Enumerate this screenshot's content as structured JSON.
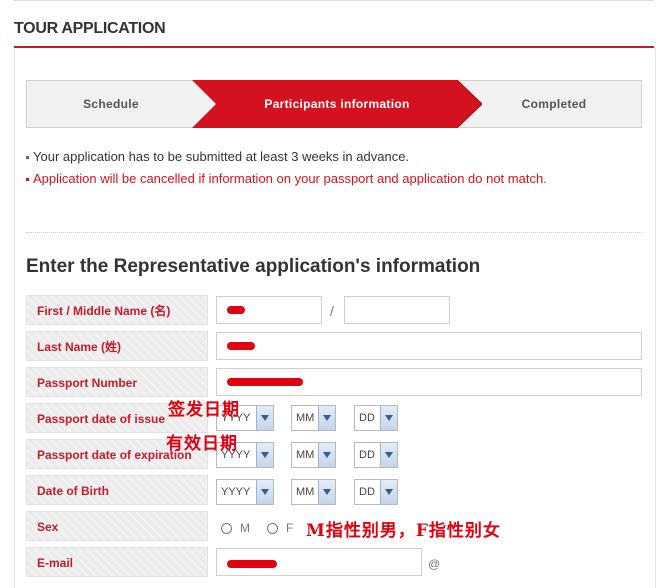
{
  "header": {
    "title": "TOUR APPLICATION"
  },
  "steps": [
    {
      "label": "Schedule",
      "active": false
    },
    {
      "label": "Participants information",
      "active": true
    },
    {
      "label": "Completed",
      "active": false
    }
  ],
  "notices": [
    "Your application has to be submitted at least 3 weeks in advance.",
    "Application will be cancelled if information on your passport and application do not match."
  ],
  "section_title": "Enter the Representative application's information",
  "form": {
    "first_name_label": "First / Middle Name (名)",
    "last_name_label": "Last Name (姓)",
    "passport_label": "Passport Number",
    "issue_label": "Passport date of issue",
    "expiration_label": "Passport date of expiration",
    "dob_label": "Date of Birth",
    "sex_label": "Sex",
    "email_label": "E-mail",
    "slash": "/",
    "at": "@",
    "year": "YYYY",
    "month": "MM",
    "day": "DD",
    "sex_m": "M",
    "sex_f": "F"
  },
  "annotations": {
    "issue": "签发日期",
    "expiration": "有效日期",
    "sex": "M指性别男，F指性别女"
  },
  "colors": {
    "accent": "#c41b2c",
    "redaction": "#e0000f"
  }
}
